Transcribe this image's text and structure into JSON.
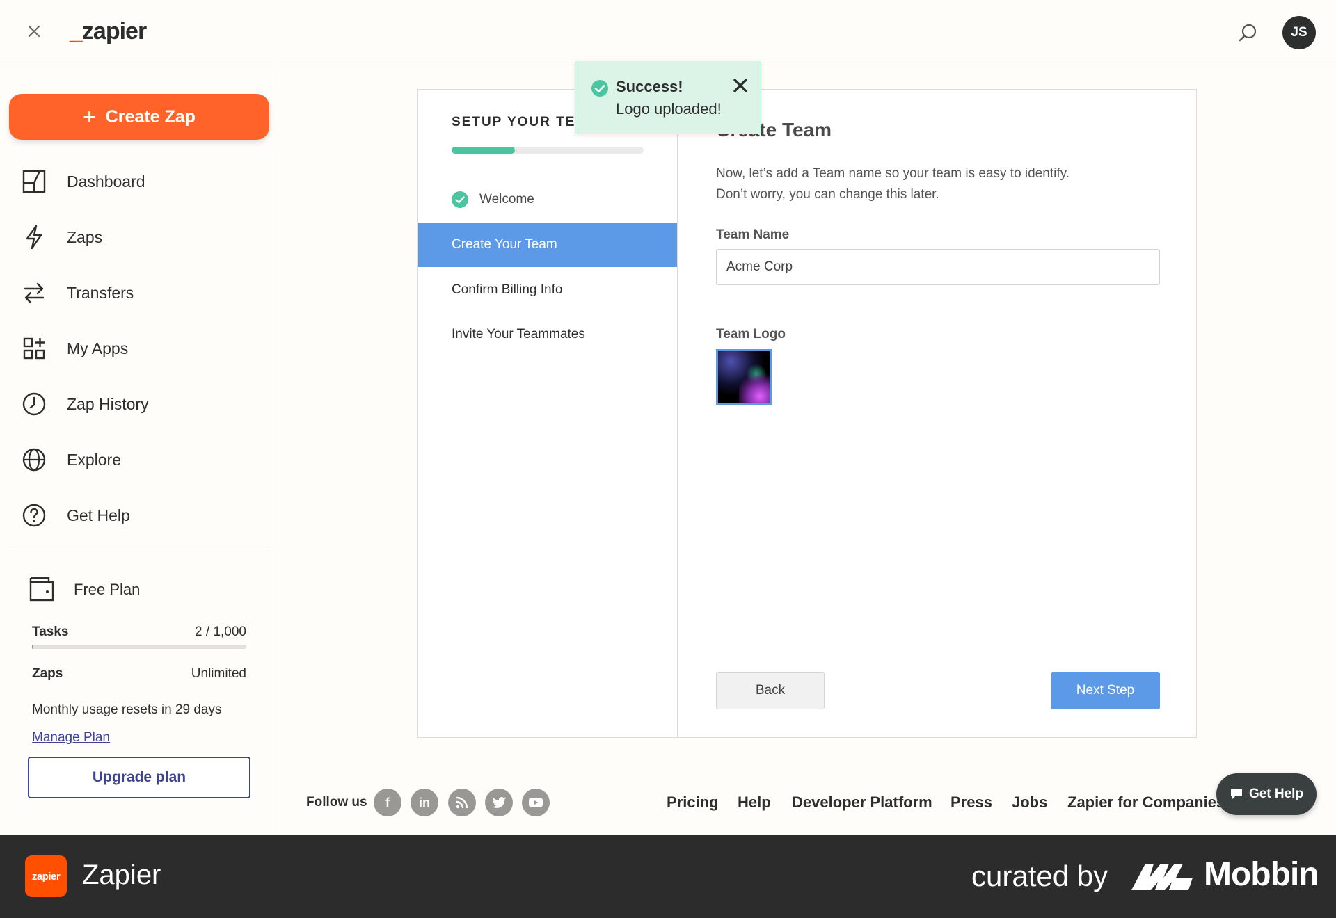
{
  "header": {
    "logo_underscore": "_",
    "logo_text": "zapier",
    "avatar_initials": "JS"
  },
  "sidebar": {
    "create_zap_label": "Create Zap",
    "nav": [
      {
        "label": "Dashboard",
        "icon": "dashboard-icon"
      },
      {
        "label": "Zaps",
        "icon": "lightning-icon"
      },
      {
        "label": "Transfers",
        "icon": "transfer-arrows-icon"
      },
      {
        "label": "My Apps",
        "icon": "apps-grid-icon"
      },
      {
        "label": "Zap History",
        "icon": "clock-icon"
      },
      {
        "label": "Explore",
        "icon": "globe-icon"
      },
      {
        "label": "Get Help",
        "icon": "help-circle-icon"
      }
    ],
    "plan": {
      "title": "Free Plan",
      "tasks_label": "Tasks",
      "tasks_value": "2 / 1,000",
      "tasks_fraction": 0.002,
      "zaps_label": "Zaps",
      "zaps_value": "Unlimited",
      "resets_text": "Monthly usage resets in 29 days",
      "manage_label": "Manage Plan",
      "upgrade_label": "Upgrade plan"
    }
  },
  "setup": {
    "title": "SETUP YOUR TEAM",
    "progress_fraction": 0.33,
    "steps": [
      {
        "label": "Welcome",
        "state": "done"
      },
      {
        "label": "Create Your Team",
        "state": "active"
      },
      {
        "label": "Confirm Billing Info",
        "state": "pending"
      },
      {
        "label": "Invite Your Teammates",
        "state": "pending"
      }
    ]
  },
  "form": {
    "title": "Create Team",
    "desc_line1": "Now, let’s add a Team name so your team is easy to identify.",
    "desc_line2": "Don’t worry, you can change this later.",
    "team_name_label": "Team Name",
    "team_name_value": "Acme Corp",
    "team_logo_label": "Team Logo",
    "back_label": "Back",
    "next_label": "Next Step"
  },
  "toast": {
    "title": "Success!",
    "message": "Logo uploaded!"
  },
  "footer": {
    "follow_label": "Follow us",
    "social": [
      {
        "icon": "facebook-icon",
        "glyph": "f"
      },
      {
        "icon": "linkedin-icon",
        "glyph": "in"
      },
      {
        "icon": "rss-icon",
        "glyph": ""
      },
      {
        "icon": "twitter-icon",
        "glyph": ""
      },
      {
        "icon": "youtube-icon",
        "glyph": ""
      }
    ],
    "links": [
      "Pricing",
      "Help",
      "Developer Platform",
      "Press",
      "Jobs",
      "Zapier for Companies"
    ],
    "get_help_label": "Get Help"
  },
  "banner": {
    "app_icon_text": "zapier",
    "app_name": "Zapier",
    "curated_by": "curated by",
    "brand": "Mobbin"
  },
  "colors": {
    "accent": "#ff4f00",
    "create_button": "#ff6329",
    "step_active": "#5c9ae8",
    "progress": "#4bc5a0",
    "toast_bg": "#dcf3e8",
    "upgrade": "#3d4592"
  }
}
